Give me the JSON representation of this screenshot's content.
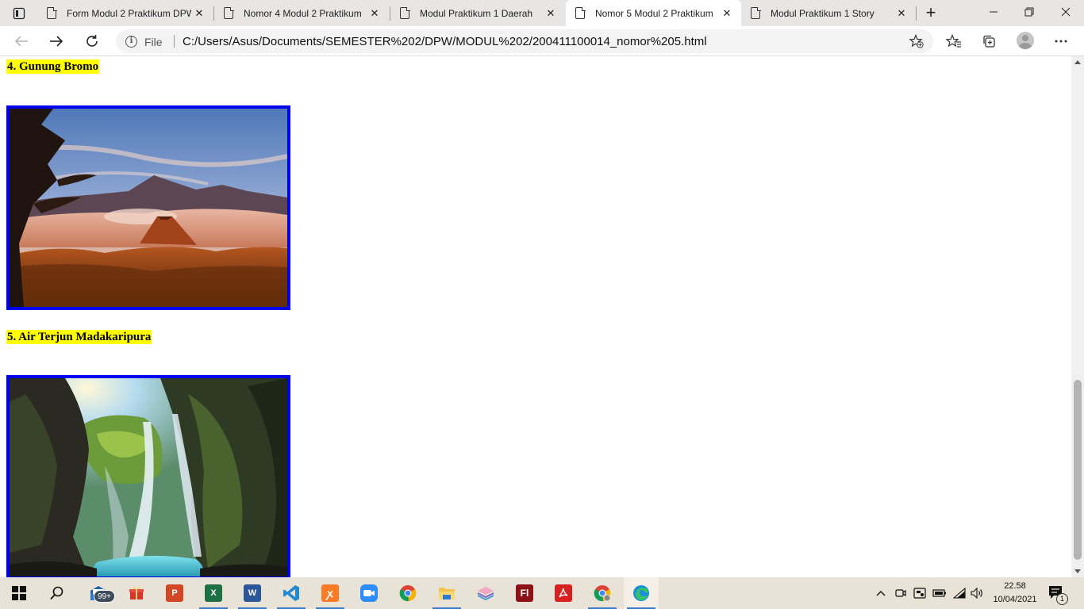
{
  "browser": {
    "tabs": [
      {
        "title": "Form Modul 2 Praktikum DPW",
        "close": "✕",
        "active": false
      },
      {
        "title": "Nomor 4 Modul 2 Praktikum",
        "close": "✕",
        "active": false
      },
      {
        "title": "Modul Praktikum 1 Daerah",
        "close": "✕",
        "active": false
      },
      {
        "title": "Nomor 5 Modul 2 Praktikum",
        "close": "✕",
        "active": true
      },
      {
        "title": "Modul Praktikum 1 Story",
        "close": "✕",
        "active": false
      }
    ],
    "new_tab": "+",
    "address": {
      "scheme_label": "File",
      "url": "C:/Users/Asus/Documents/SEMESTER%202/DPW/MODUL%202/200411100014_nomor%205.html"
    }
  },
  "page": {
    "sections": [
      {
        "caption": "4. Gunung Bromo",
        "image": "mount-bromo-sunrise-photo"
      },
      {
        "caption": "5. Air Terjun Madakaripura",
        "image": "madakaripura-waterfall-photo"
      }
    ]
  },
  "taskbar": {
    "mail_badge": "99+",
    "apps": [
      "file-explorer-mail",
      "gift",
      "powerpoint",
      "excel",
      "word",
      "vscode",
      "xampp",
      "zoom",
      "chrome",
      "file-explorer",
      "app-stack",
      "flash",
      "acrobat",
      "chrome-canary",
      "edge"
    ],
    "clock": {
      "time": "22.58",
      "date": "10/04/2021"
    },
    "notification_count": "1"
  },
  "colors": {
    "caption_highlight": "#ffff00",
    "image_border": "#0000ee"
  }
}
